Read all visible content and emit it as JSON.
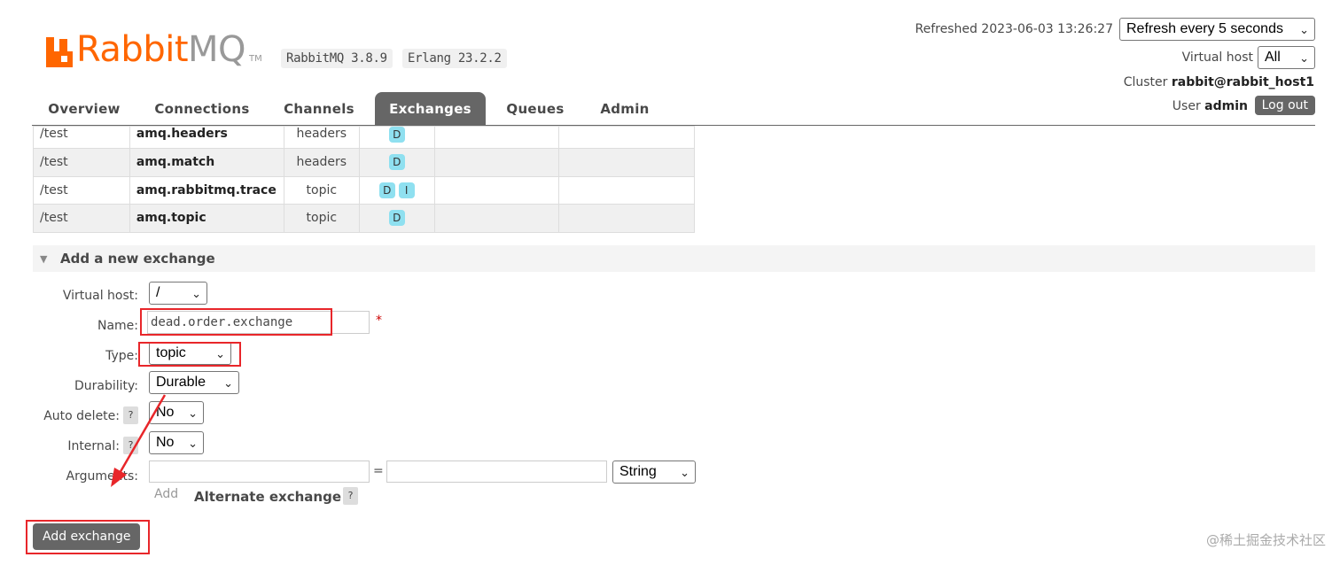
{
  "header": {
    "brand": "Rabbit",
    "brand_suffix": "MQ",
    "tm": "TM",
    "version_badge": "RabbitMQ 3.8.9",
    "erlang_badge": "Erlang 23.2.2",
    "refreshed": "Refreshed 2023-06-03 13:26:27",
    "refresh_select": "Refresh every 5 seconds",
    "vhost_label": "Virtual host",
    "vhost_value": "All",
    "cluster_label": "Cluster",
    "cluster_value": "rabbit@rabbit_host1",
    "user_label": "User",
    "user_value": "admin",
    "logout": "Log out"
  },
  "tabs": [
    {
      "label": "Overview"
    },
    {
      "label": "Connections"
    },
    {
      "label": "Channels"
    },
    {
      "label": "Exchanges",
      "active": true
    },
    {
      "label": "Queues"
    },
    {
      "label": "Admin"
    }
  ],
  "exchanges": [
    {
      "vhost": "/test",
      "name": "amq.headers",
      "type": "headers",
      "features": [
        "D"
      ]
    },
    {
      "vhost": "/test",
      "name": "amq.match",
      "type": "headers",
      "features": [
        "D"
      ]
    },
    {
      "vhost": "/test",
      "name": "amq.rabbitmq.trace",
      "type": "topic",
      "features": [
        "D",
        "I"
      ]
    },
    {
      "vhost": "/test",
      "name": "amq.topic",
      "type": "topic",
      "features": [
        "D"
      ]
    }
  ],
  "form": {
    "section_title": "Add a new exchange",
    "vhost_label": "Virtual host:",
    "vhost_value": "/",
    "name_label": "Name:",
    "name_value": "dead.order.exchange",
    "required_mark": "*",
    "type_label": "Type:",
    "type_value": "topic",
    "durability_label": "Durability:",
    "durability_value": "Durable",
    "auto_delete_label": "Auto delete:",
    "auto_delete_value": "No",
    "internal_label": "Internal:",
    "internal_value": "No",
    "arguments_label": "Arguments:",
    "equals": "=",
    "arg_type_value": "String",
    "add_link": "Add",
    "alternate_exchange": "Alternate exchange",
    "help": "?",
    "submit": "Add exchange"
  },
  "watermark": "@稀土掘金技术社区",
  "colors": {
    "brand": "#ff6600",
    "tab_active": "#666666",
    "annotation": "#e8262a",
    "feature_badge": "#8fe0f0"
  }
}
